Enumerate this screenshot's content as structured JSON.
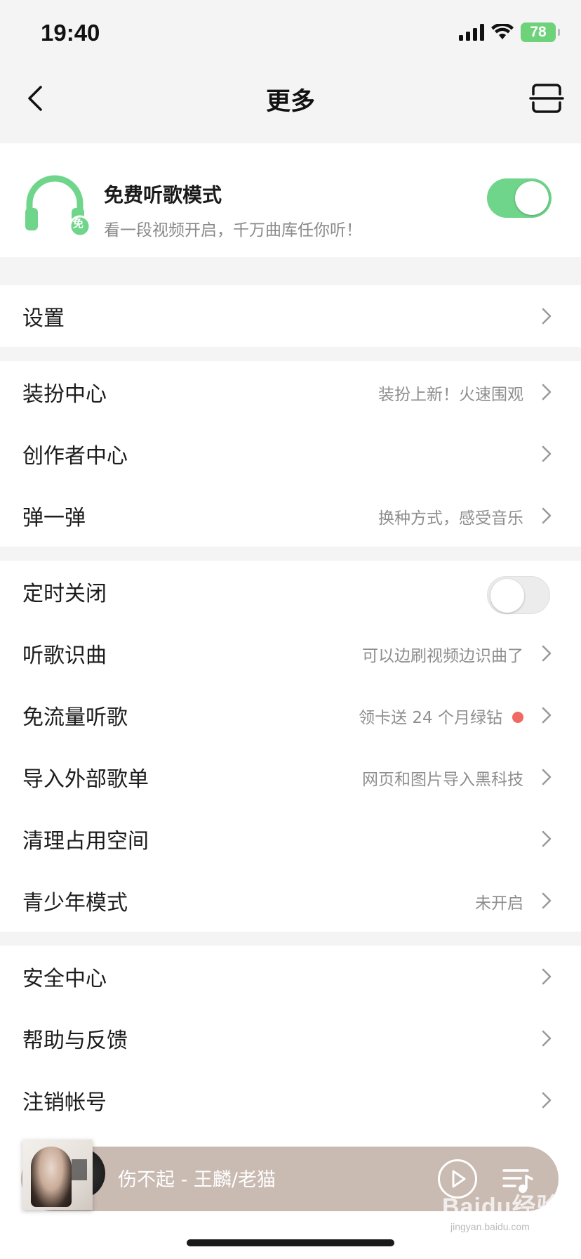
{
  "status_bar": {
    "time": "19:40",
    "battery": "78"
  },
  "nav": {
    "title": "更多"
  },
  "free_mode": {
    "title": "免费听歌模式",
    "subtitle": "看一段视频开启，千万曲库任你听！",
    "badge": "免",
    "enabled": true
  },
  "settings": {
    "label": "设置"
  },
  "group_features": [
    {
      "label": "装扮中心",
      "hint": "装扮上新！火速围观"
    },
    {
      "label": "创作者中心",
      "hint": ""
    },
    {
      "label": "弹一弹",
      "hint": "换种方式，感受音乐"
    }
  ],
  "group_tools": {
    "timer": {
      "label": "定时关闭",
      "enabled": false
    },
    "items": [
      {
        "label": "听歌识曲",
        "hint": "可以边刷视频边识曲了"
      },
      {
        "label": "免流量听歌",
        "hint": "领卡送 24 个月绿钻",
        "red_dot": true
      },
      {
        "label": "导入外部歌单",
        "hint": "网页和图片导入黑科技"
      },
      {
        "label": "清理占用空间",
        "hint": ""
      },
      {
        "label": "青少年模式",
        "hint": "未开启"
      }
    ]
  },
  "group_account": [
    {
      "label": "安全中心"
    },
    {
      "label": "帮助与反馈"
    },
    {
      "label": "注销帐号"
    }
  ],
  "mini_player": {
    "song": "伤不起 - 王麟/老猫"
  },
  "watermark": {
    "text": "Baidu经验",
    "sub": "jingyan.baidu.com"
  },
  "colors": {
    "accent_green": "#6fd58a",
    "red_dot": "#ee6a62",
    "player_bg": "#c9bab2"
  }
}
